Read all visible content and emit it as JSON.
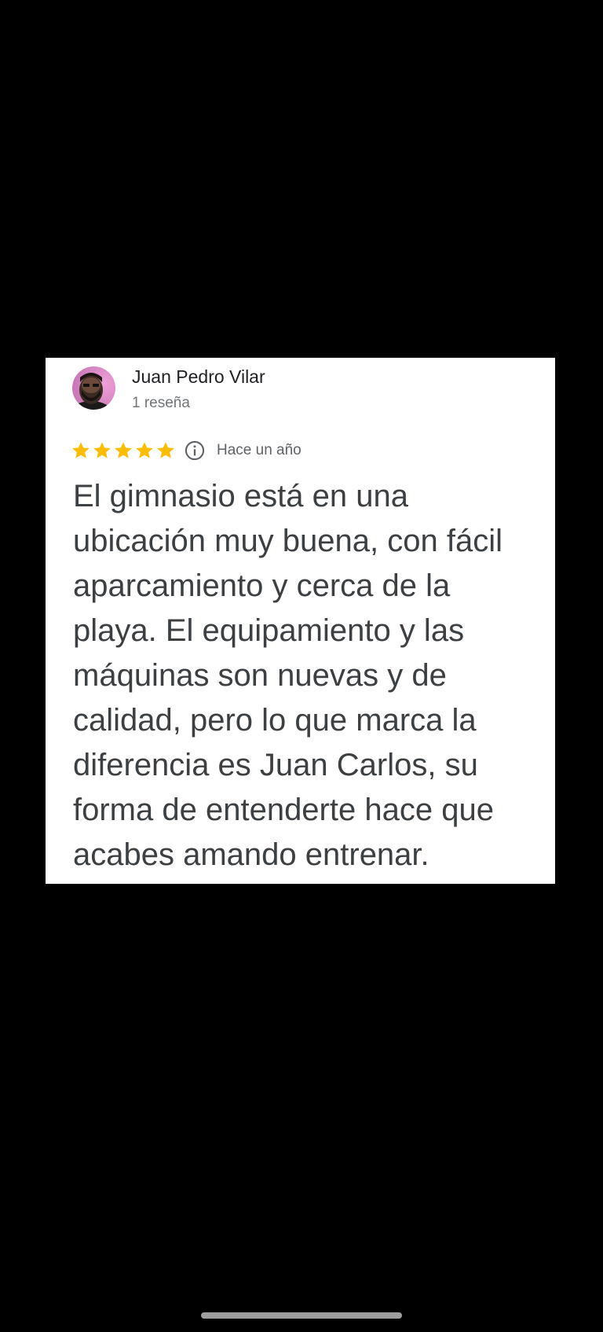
{
  "review": {
    "author_name": "Juan Pedro Vilar",
    "author_meta": "1 reseña",
    "rating": 5,
    "rating_max": 5,
    "star_color": "#fbbc04",
    "date": "Hace un año",
    "text": "El gimnasio está en una\nubicación muy buena, con fácil\naparcamiento y cerca de la\nplaya. El equipamiento y las\nmáquinas son nuevas y de\ncalidad, pero lo que marca la\ndiferencia es Juan Carlos, su\nforma de entenderte hace que\nacabes amando entrenar."
  },
  "icons": {
    "star": "star-icon",
    "info": "info-icon",
    "avatar": "user-avatar"
  },
  "colors": {
    "background": "#000000",
    "card": "#ffffff",
    "text_primary": "#202124",
    "text_secondary": "#70757a"
  }
}
